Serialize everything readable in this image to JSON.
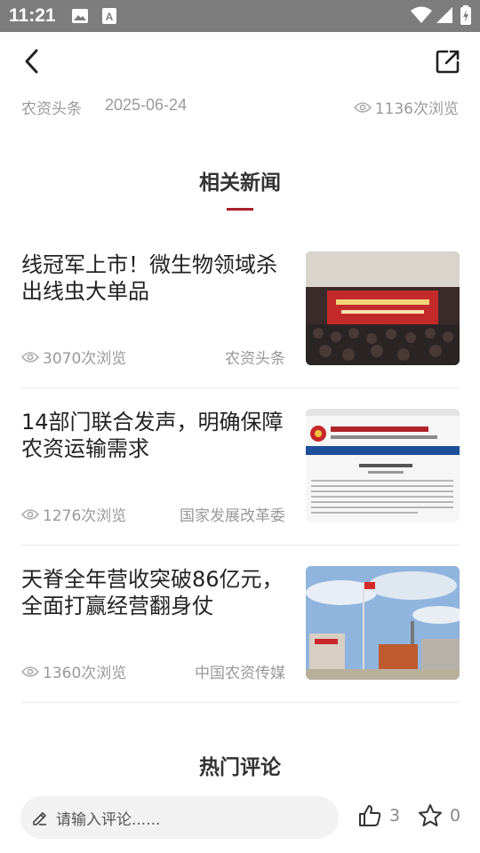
{
  "status_bar": {
    "time": "11:21"
  },
  "article_meta": {
    "source": "农资头条",
    "date": "2025-06-24",
    "views": "1136次浏览"
  },
  "related": {
    "heading": "相关新闻",
    "items": [
      {
        "title": "线冠军上市！微生物领域杀出线虫大单品",
        "views": "3070次浏览",
        "source": "农资头条",
        "thumb": "conference-photo"
      },
      {
        "title": "14部门联合发声，明确保障农资运输需求",
        "views": "1276次浏览",
        "source": "国家发展改革委",
        "thumb": "webpage-screenshot"
      },
      {
        "title": "天脊全年营收突破86亿元，全面打赢经营翻身仗",
        "views": "1360次浏览",
        "source": "中国农资传媒",
        "thumb": "factory-photo"
      }
    ]
  },
  "hot_comments": {
    "heading": "热门评论"
  },
  "comment_bar": {
    "placeholder": "请输入评论......",
    "likes": "3",
    "favorites": "0"
  },
  "colors": {
    "accent": "#a8202a",
    "status_bar": "#7d7d7d"
  }
}
